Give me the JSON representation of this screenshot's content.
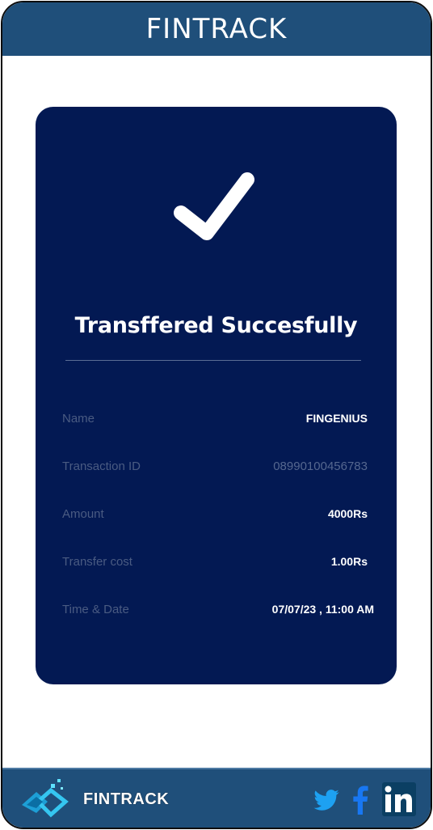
{
  "header": {
    "title": "FINTRACK"
  },
  "card": {
    "status_message": "Transffered Succesfully",
    "details": [
      {
        "label": "Name",
        "value": "FINGENIUS"
      },
      {
        "label": "Transaction ID",
        "value": "08990100456783"
      },
      {
        "label": "Amount",
        "value": "4000Rs"
      },
      {
        "label": "Transfer cost",
        "value": "1.00Rs"
      },
      {
        "label": "Time & Date",
        "value": "07/07/23 , 11:00 AM"
      }
    ]
  },
  "footer": {
    "brand": "FINTRACK",
    "social": [
      "twitter-icon",
      "facebook-icon",
      "linkedin-icon"
    ]
  },
  "colors": {
    "header_bg": "#1f4f7a",
    "card_bg": "#031953",
    "twitter": "#1da1f2",
    "facebook": "#1877f2",
    "linkedin": "#ffffff"
  }
}
